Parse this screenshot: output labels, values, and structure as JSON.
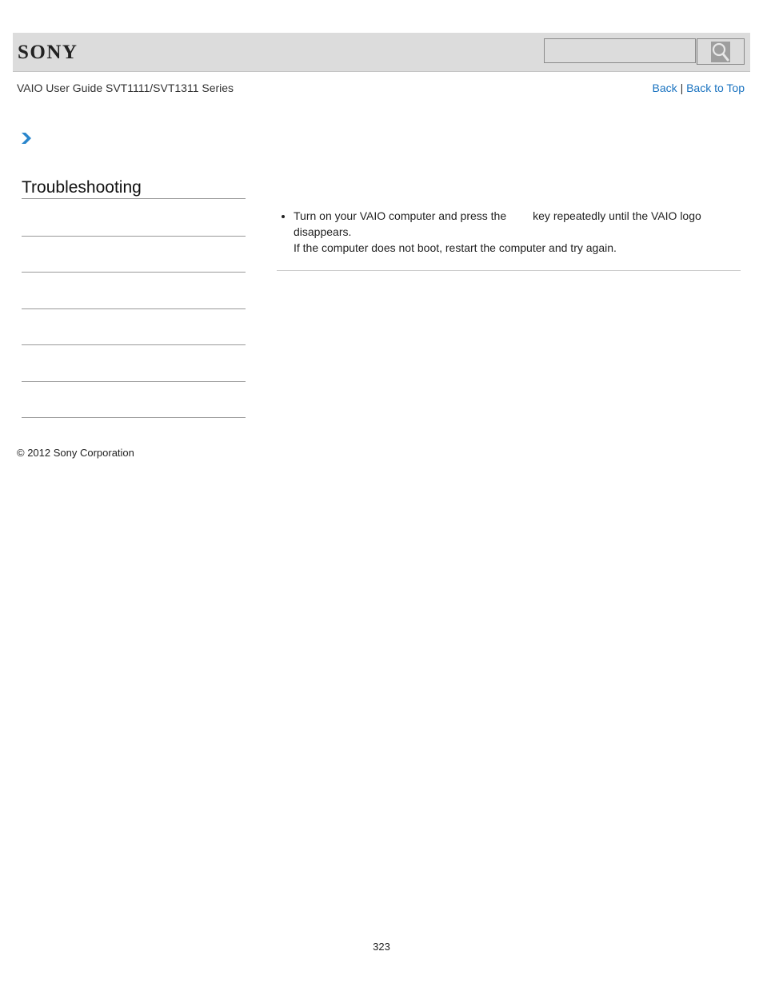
{
  "header": {
    "logo": "SONY",
    "search": {
      "value": "",
      "placeholder": "",
      "button_icon": "search-icon"
    }
  },
  "subheader": {
    "title": "VAIO User Guide SVT1111/SVT1311 Series",
    "links": {
      "back": "Back",
      "separator": "|",
      "back_to_top": "Back to Top"
    }
  },
  "breadcrumb": {
    "icon": "chevron-right-icon",
    "accent": "#1a73c0"
  },
  "sidebar": {
    "title": "Troubleshooting",
    "item_count": 6
  },
  "content": {
    "bullet_line1_before_key": "Turn on your VAIO computer and press the",
    "bullet_line1_after_key": "key repeatedly until the VAIO logo disappears.",
    "bullet_line2": "If the computer does not boot, restart the computer and try again."
  },
  "footer": {
    "copyright": "© 2012 Sony Corporation",
    "page_number": "323"
  }
}
